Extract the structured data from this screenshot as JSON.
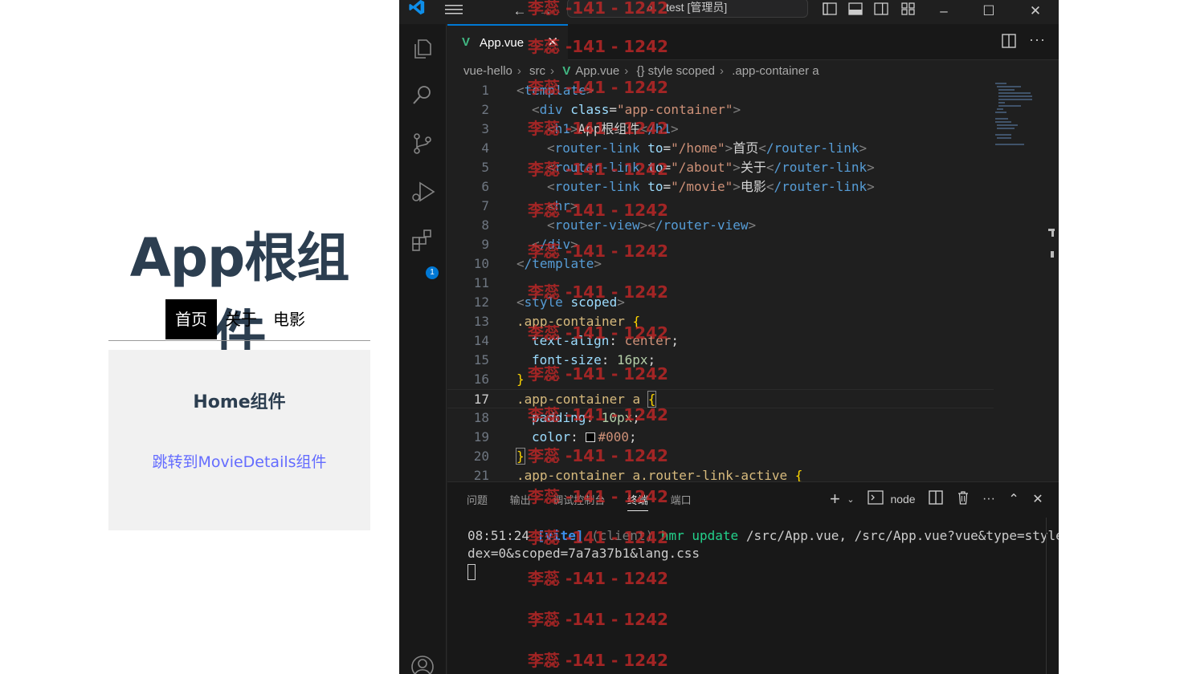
{
  "app_preview": {
    "title": "App根组件",
    "nav": [
      "首页",
      "关于",
      "电影"
    ],
    "home_title": "Home组件",
    "movie_link": "跳转到MovieDetails组件"
  },
  "titlebar": {
    "back_icon": "arrow-left-icon",
    "forward_icon": "arrow-right-icon",
    "search_text": "test [管理员]"
  },
  "editor": {
    "tab_label": "App.vue",
    "tab_close": "✕",
    "breadcrumb": [
      "vue-hello",
      "src",
      "App.vue",
      "{} style scoped",
      ".app-container a"
    ],
    "current_line": 17
  },
  "code_lines": [
    [
      "1",
      "template"
    ],
    [
      "2",
      "div class"
    ],
    [
      "3",
      "h1"
    ],
    [
      "4",
      "router-link home"
    ],
    [
      "5",
      "router-link about"
    ],
    [
      "6",
      "router-link movie"
    ],
    [
      "7",
      "hr"
    ],
    [
      "8",
      "router-view"
    ],
    [
      "9",
      "/div"
    ],
    [
      "10",
      "/template"
    ],
    [
      "11",
      ""
    ],
    [
      "12",
      "style scoped"
    ],
    [
      "13",
      ".app-container {"
    ],
    [
      "14",
      "text-align"
    ],
    [
      "15",
      "font-size"
    ],
    [
      "16",
      "}"
    ],
    [
      "17",
      ".app-container a {"
    ],
    [
      "18",
      "padding"
    ],
    [
      "19",
      "color"
    ],
    [
      "20",
      "}"
    ],
    [
      "21",
      ".app-container a.router-link-active {"
    ]
  ],
  "code": {
    "l1_tag": "template",
    "l2_tag": "div",
    "l2_attr": "class",
    "l2_val": "\"app-container\"",
    "l3_tag": "h1",
    "l3_text": "App根组件",
    "l3_close": "/h1",
    "l4_tag": "router-link",
    "l4_attr": "to",
    "l4_val": "\"/home\"",
    "l4_text": "首页",
    "l4_close": "/router-link",
    "l5_tag": "router-link",
    "l5_attr": "to",
    "l5_val": "\"/about\"",
    "l5_text": "关于",
    "l5_close": "/router-link",
    "l6_tag": "router-link",
    "l6_attr": "to",
    "l6_val": "\"/movie\"",
    "l6_text": "电影",
    "l6_close": "/router-link",
    "l7_tag": "hr",
    "l8_tag": "router-view",
    "l8_close": "/router-view",
    "l9_tag": "/div",
    "l10_tag": "/template",
    "l12_tag": "style",
    "l12_attr": "scoped",
    "l13_sel": ".app-container",
    "l14_prop": "text-align",
    "l14_val": "center",
    "l15_prop": "font-size",
    "l15_val": "16px",
    "l17_sel": ".app-container a",
    "l18_prop": "padding",
    "l18_val": "10px",
    "l19_prop": "color",
    "l19_val": "#000",
    "l21_sel": ".app-container a.router-link-active"
  },
  "panel": {
    "tabs": [
      "问题",
      "输出",
      "调试控制台",
      "终端",
      "端口"
    ],
    "active_tab": "终端",
    "shell": "node",
    "terminal_time": "08:51:24",
    "terminal_tag": "[vite]",
    "terminal_client": "(client)",
    "terminal_hmr": "hmr update",
    "terminal_paths": "/src/App.vue, /src/App.vue?vue&type=style&in",
    "terminal_line2": "dex=0&scoped=7a7a37b1&lang.css"
  },
  "badges": {
    "extensions_count": "1"
  },
  "watermark": "李蕊 -141 - 1242",
  "colors": {
    "vue_green": "#41b883",
    "accent_blue": "#0078d4",
    "title_color": "#2c3e50",
    "link_color": "#646cff"
  }
}
